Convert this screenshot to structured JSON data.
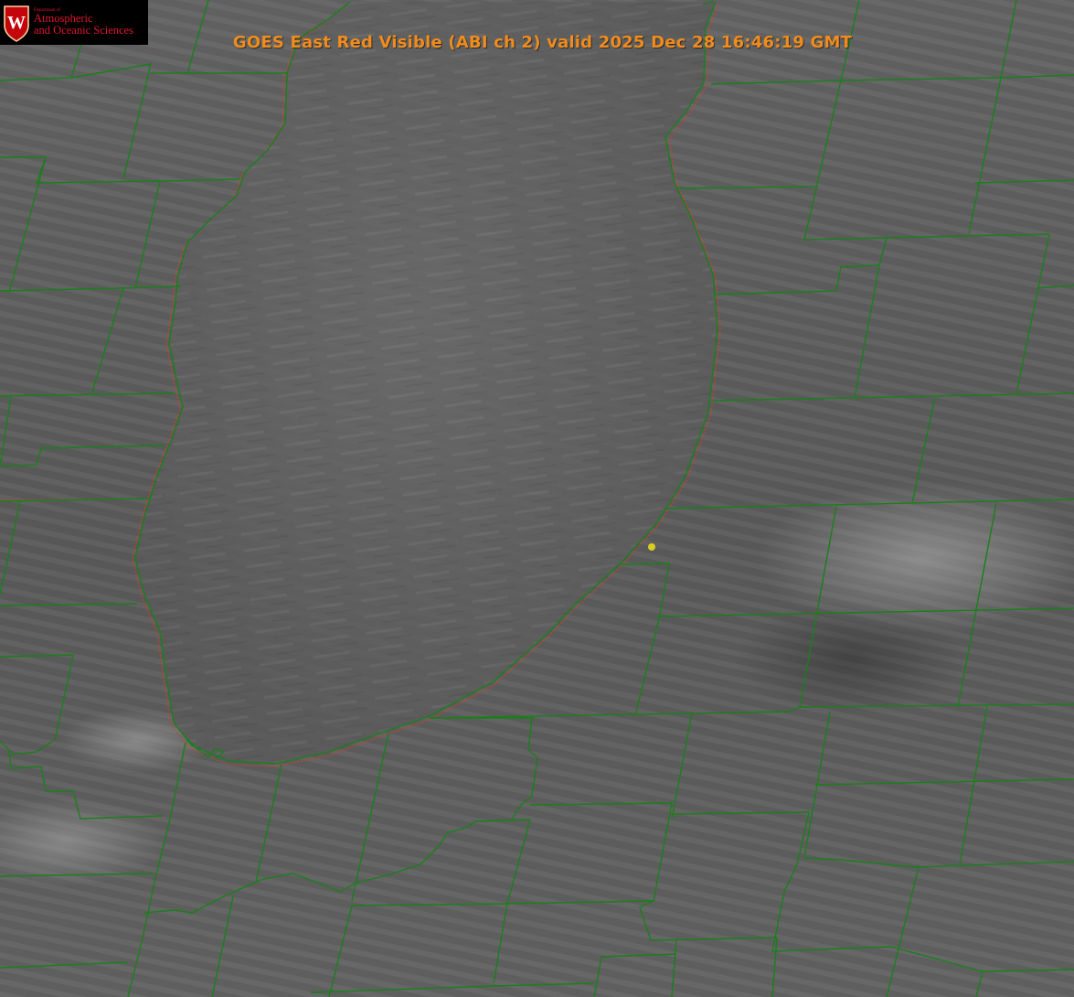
{
  "header": {
    "title": "GOES East Red Visible (ABI ch 2) valid 2025 Dec 28 16:46:19 GMT"
  },
  "logo": {
    "crest_letter": "W",
    "dept_line": "Department of",
    "line1": "Atmospheric",
    "line2": "and Oceanic Sciences"
  },
  "map": {
    "county_line_color": "#1a7f1a",
    "state_line_color": "#e03a2a",
    "marker_color": "#d8d020",
    "title_color": "#f08c1e"
  }
}
